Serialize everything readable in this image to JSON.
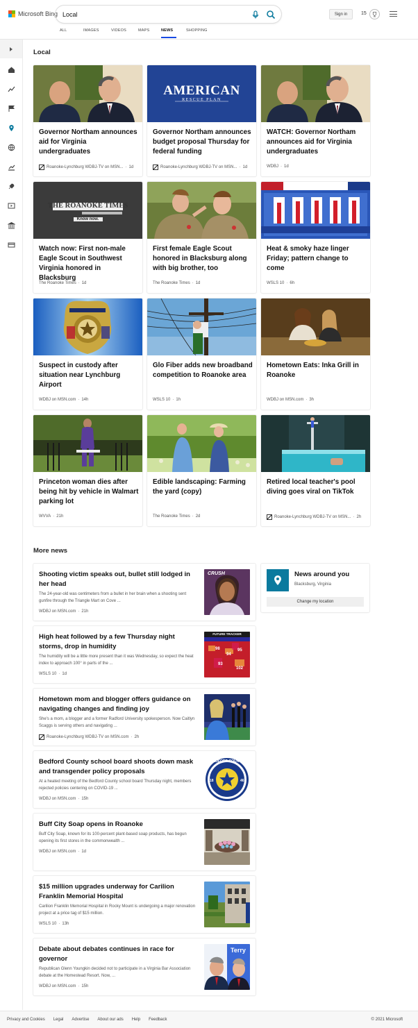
{
  "header": {
    "brand": "Microsoft Bing",
    "search_value": "Local",
    "signin_label": "Sign in",
    "rewards_count": "15",
    "tabs": [
      {
        "label": "ALL"
      },
      {
        "label": "IMAGES"
      },
      {
        "label": "VIDEOS"
      },
      {
        "label": "MAPS"
      },
      {
        "label": "NEWS"
      },
      {
        "label": "SHOPPING"
      }
    ],
    "active_tab": "NEWS"
  },
  "rail": {
    "items": [
      "expand-icon",
      "home-icon",
      "trending-icon",
      "flag-icon",
      "location-icon",
      "globe-icon",
      "business-icon",
      "science-icon",
      "entertainment-icon",
      "politics-icon",
      "money-icon"
    ]
  },
  "local": {
    "section_title": "Local",
    "cards": [
      {
        "title": "Governor Northam announces aid for Virginia undergraduates",
        "source": "Roanoke-Lynchburg WDBJ-TV on MSN...",
        "age": "1d",
        "has_logo": true,
        "image": "two-men-outdoors"
      },
      {
        "title": "Governor Northam announces budget proposal Thursday for federal funding",
        "source": "Roanoke-Lynchburg WDBJ-TV on MSN...",
        "age": "1d",
        "has_logo": true,
        "image": "american-rescue-plan"
      },
      {
        "title": "WATCH: Governor Northam announces aid for Virginia undergraduates",
        "source": "WDBJ",
        "age": "1d",
        "has_logo": false,
        "image": "two-men-outdoors"
      },
      {
        "title": "Watch now: First non-male Eagle Scout in Southwest Virginia honored in Blacksburg",
        "source": "The Roanoke Times",
        "age": "1d",
        "has_logo": false,
        "image": "roanoke-times-logo"
      },
      {
        "title": "First female Eagle Scout honored in Blacksburg along with big brother, too",
        "source": "The Roanoke Times",
        "age": "1d",
        "has_logo": false,
        "image": "scouts-saluting"
      },
      {
        "title": "Heat & smoky haze linger Friday; pattern change to come",
        "source": "WSLS 10",
        "age": "6h",
        "has_logo": false,
        "image": "weather-temperatures"
      },
      {
        "title": "Suspect in custody after situation near Lynchburg Airport",
        "source": "WDBJ on MSN.com",
        "age": "14h",
        "has_logo": false,
        "image": "police-badge"
      },
      {
        "title": "Glo Fiber adds new broadband competition to Roanoke area",
        "source": "WSLS 10",
        "age": "1h",
        "has_logo": false,
        "image": "utility-pole"
      },
      {
        "title": "Hometown Eats: Inka Grill in Roanoke",
        "source": "WDBJ on MSN.com",
        "age": "3h",
        "has_logo": false,
        "image": "restaurant-diners"
      },
      {
        "title": "Princeton woman dies after being hit by vehicle in Walmart parking lot",
        "source": "WVVA",
        "age": "21h",
        "has_logo": false,
        "image": "woman-garden-gate"
      },
      {
        "title": "Edible landscaping: Farming the yard (copy)",
        "source": "The Roanoke Times",
        "age": "2d",
        "has_logo": false,
        "image": "couple-garden"
      },
      {
        "title": "Retired local teacher's pool diving goes viral on TikTok",
        "source": "Roanoke-Lynchburg WDBJ-TV on MSN...",
        "age": "2h",
        "has_logo": true,
        "image": "pool-diving"
      }
    ]
  },
  "more_news": {
    "section_title": "More news",
    "items": [
      {
        "title": "Shooting victim speaks out, bullet still lodged in her head",
        "snippet": "The 24-year-old was centimeters from a bullet in her brain when a shooting sent gunfire through the Triangle Mart on Cove ...",
        "source": "WDBJ on MSN.com",
        "age": "21h",
        "has_logo": false,
        "thumb_label": "CRUSH"
      },
      {
        "title": "High heat followed by a few Thursday night storms, drop in humidity",
        "snippet": "The humidity will be a little more present than it was Wednesday, so expect the heat index to approach 100° in parts of the ...",
        "source": "WSLS 10",
        "age": "1d",
        "has_logo": false,
        "thumb_label": "FUTURE TRACKER"
      },
      {
        "title": "Hometown mom and blogger offers guidance on navigating changes and finding joy",
        "snippet": "She's a mom, a blogger and a former Radford University spokesperson. Now Caitlyn Scaggs is serving others and navigating ...",
        "source": "Roanoke-Lynchburg WDBJ-TV on MSN.com",
        "age": "2h",
        "has_logo": true,
        "thumb_label": ""
      },
      {
        "title": "Bedford County school board shoots down mask and transgender policy proposals",
        "snippet": "At a heated meeting of the Bedford County school board Thursday night, members rejected policies centering on COVID-19 ...",
        "source": "WDBJ on MSN.com",
        "age": "15h",
        "has_logo": false,
        "thumb_label": "BEDFORD COUNTY"
      },
      {
        "title": "Buff City Soap opens in Roanoke",
        "snippet": "Buff City Soap, known for its 100-percent plant-based soap products, has begun opening its first stores in the commonwealth ...",
        "source": "WDBJ on MSN.com",
        "age": "1d",
        "has_logo": false,
        "thumb_label": ""
      },
      {
        "title": "$15 million upgrades underway for Carilion Franklin Memorial Hospital",
        "snippet": "Carilion Franklin Memorial Hospital in Rocky Mount is undergoing a major renovation project at a price tag of $15 million.",
        "source": "WSLS 10",
        "age": "13h",
        "has_logo": false,
        "thumb_label": ""
      },
      {
        "title": "Debate about debates continues in race for governor",
        "snippet": "Republican Glenn Youngkin decided not to participate in a Virginia Bar Association debate at the Homestead Resort. Now, ...",
        "source": "WDBJ on MSN.com",
        "age": "15h",
        "has_logo": false,
        "thumb_label": "Terry"
      }
    ]
  },
  "news_around": {
    "title": "News around you",
    "location": "Blacksburg, Virginia",
    "button_label": "Change my location"
  },
  "footer": {
    "links": [
      "Privacy and Cookies",
      "Legal",
      "Advertise",
      "About our ads",
      "Help",
      "Feedback"
    ],
    "copyright": "© 2021 Microsoft"
  },
  "colors": {
    "accent": "#174ae4",
    "location_tile": "#0b7a9e",
    "search_icon": "#0b7a9e"
  }
}
